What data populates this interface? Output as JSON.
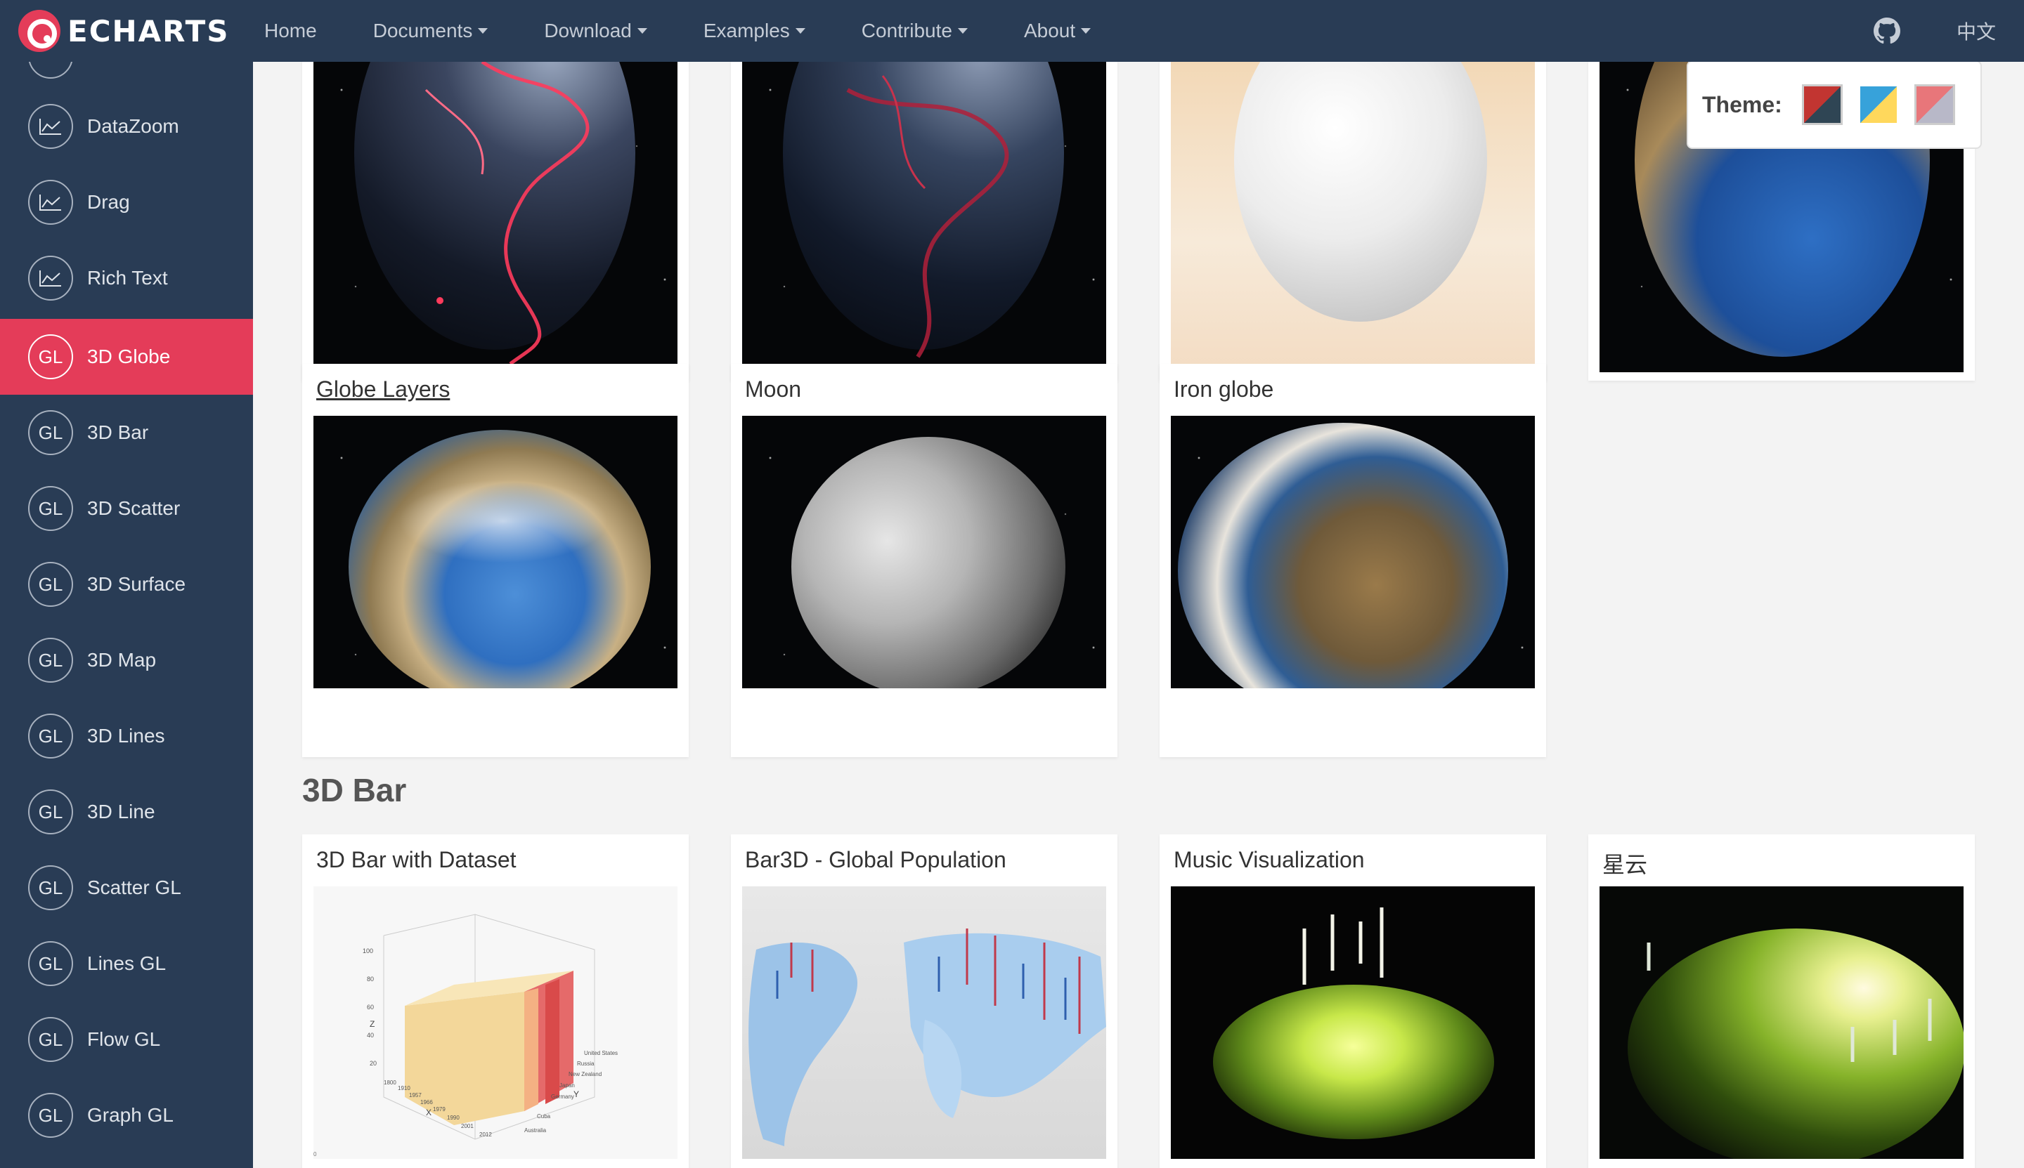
{
  "brand": {
    "name": "ECHARTS"
  },
  "nav": {
    "items": [
      {
        "label": "Home",
        "dropdown": false
      },
      {
        "label": "Documents",
        "dropdown": true
      },
      {
        "label": "Download",
        "dropdown": true
      },
      {
        "label": "Examples",
        "dropdown": true
      },
      {
        "label": "Contribute",
        "dropdown": true
      },
      {
        "label": "About",
        "dropdown": true
      }
    ],
    "github_icon": "github-icon",
    "language": "中文"
  },
  "sidebar": {
    "items": [
      {
        "label": "DataZoom",
        "icon": "line-chart-icon",
        "badge": "",
        "active": false
      },
      {
        "label": "Drag",
        "icon": "line-chart-icon",
        "badge": "",
        "active": false
      },
      {
        "label": "Rich Text",
        "icon": "line-chart-icon",
        "badge": "",
        "active": false
      },
      {
        "label": "3D Globe",
        "icon": "gl-icon",
        "badge": "GL",
        "active": true
      },
      {
        "label": "3D Bar",
        "icon": "gl-icon",
        "badge": "GL",
        "active": false
      },
      {
        "label": "3D Scatter",
        "icon": "gl-icon",
        "badge": "GL",
        "active": false
      },
      {
        "label": "3D Surface",
        "icon": "gl-icon",
        "badge": "GL",
        "active": false
      },
      {
        "label": "3D Map",
        "icon": "gl-icon",
        "badge": "GL",
        "active": false
      },
      {
        "label": "3D Lines",
        "icon": "gl-icon",
        "badge": "GL",
        "active": false
      },
      {
        "label": "3D Line",
        "icon": "gl-icon",
        "badge": "GL",
        "active": false
      },
      {
        "label": "Scatter GL",
        "icon": "gl-icon",
        "badge": "GL",
        "active": false
      },
      {
        "label": "Lines GL",
        "icon": "gl-icon",
        "badge": "GL",
        "active": false
      },
      {
        "label": "Flow GL",
        "icon": "gl-icon",
        "badge": "GL",
        "active": false
      },
      {
        "label": "Graph GL",
        "icon": "gl-icon",
        "badge": "GL",
        "active": false
      }
    ]
  },
  "theme": {
    "label": "Theme:",
    "swatches": [
      {
        "name": "dark-red",
        "colors": [
          "#c23531",
          "#2f4554"
        ]
      },
      {
        "name": "light-blue-yellow",
        "colors": [
          "#37a2da",
          "#ffd85c"
        ]
      },
      {
        "name": "light-red",
        "colors": [
          "#e8767a",
          "#b8b8c8"
        ]
      }
    ]
  },
  "globe_section": {
    "top_cards": [
      {
        "title": ""
      },
      {
        "title": ""
      },
      {
        "title": ""
      },
      {
        "title": ""
      }
    ],
    "cards": [
      {
        "title": "Globe Layers"
      },
      {
        "title": "Moon"
      },
      {
        "title": "Iron globe"
      }
    ]
  },
  "bar_section": {
    "title": "3D Bar",
    "cards": [
      {
        "title": "3D Bar with Dataset"
      },
      {
        "title": "Bar3D - Global Population"
      },
      {
        "title": "Music Visualization"
      },
      {
        "title": "星云"
      }
    ],
    "dataset_thumb": {
      "z_label": "Z",
      "x_label": "X",
      "y_label": "Y",
      "z_ticks": [
        "100",
        "80",
        "60",
        "40",
        "20"
      ],
      "x_ticks": [
        "1800",
        "1910",
        "1957",
        "1966",
        "1979",
        "1990",
        "2001",
        "2012"
      ],
      "y_ticks": [
        "United States",
        "Russia",
        "New Zealand",
        "Japan",
        "Germany",
        "Cuba",
        "Australia"
      ],
      "corner": "0"
    }
  }
}
